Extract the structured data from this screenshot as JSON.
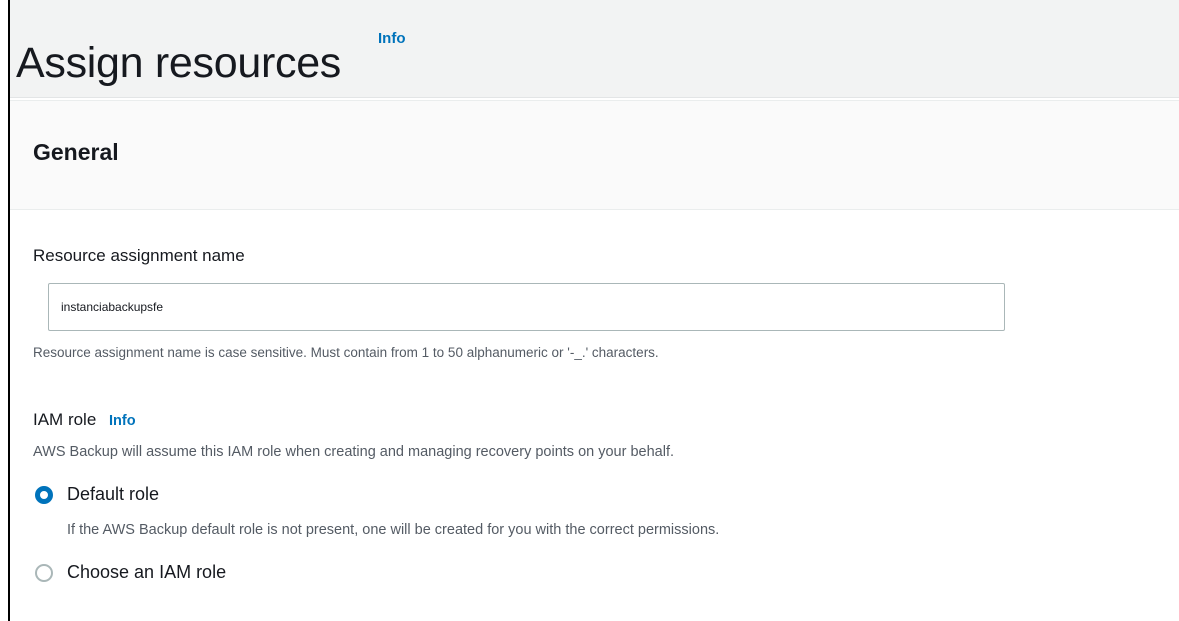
{
  "page": {
    "title": "Assign resources",
    "info_link": "Info"
  },
  "general": {
    "section_title": "General",
    "name_field": {
      "label": "Resource assignment name",
      "value": "instanciabackupsfe",
      "constraint": "Resource assignment name is case sensitive. Must contain from 1 to 50 alphanumeric or '-_.' characters."
    },
    "iam_role": {
      "label": "IAM role",
      "info_link": "Info",
      "description": "AWS Backup will assume this IAM role when creating and managing recovery points on your behalf.",
      "options": [
        {
          "label": "Default role",
          "description": "If the AWS Backup default role is not present, one will be created for you with the correct permissions.",
          "selected": true
        },
        {
          "label": "Choose an IAM role",
          "selected": false
        }
      ]
    }
  },
  "colors": {
    "link": "#0073bb",
    "radio_selected": "#0073bb",
    "header_bg": "#f2f3f3"
  }
}
